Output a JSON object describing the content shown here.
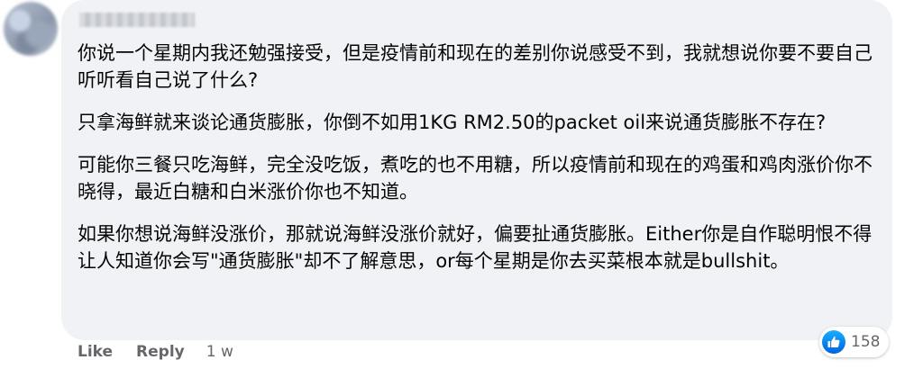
{
  "comment": {
    "paragraphs": [
      "你说一个星期内我还勉强接受，但是疫情前和现在的差别你说感受不到，我就想说你要不要自己听听看自己说了什么?",
      "只拿海鲜就来谈论通货膨胀，你倒不如用1KG RM2.50的packet oil来说通货膨胀不存在?",
      "可能你三餐只吃海鲜，完全没吃饭，煮吃的也不用糖，所以疫情前和现在的鸡蛋和鸡肉涨价你不晓得，最近白糖和白米涨价你也不知道。",
      "如果你想说海鲜没涨价，那就说海鲜没涨价就好，偏要扯通货膨胀。Either你是自作聪明恨不得让人知道你会写\"通货膨胀\"却不了解意思，or每个星期是你去买菜根本就是bullshit。"
    ]
  },
  "actions": {
    "like_label": "Like",
    "reply_label": "Reply",
    "time": "1 w"
  },
  "reactions": {
    "icon": "thumbs-up-icon",
    "count": "158"
  },
  "colors": {
    "bubble_bg": "#f0f2f5",
    "text": "#050505",
    "meta": "#65676b",
    "like_blue": "#0866ff"
  }
}
